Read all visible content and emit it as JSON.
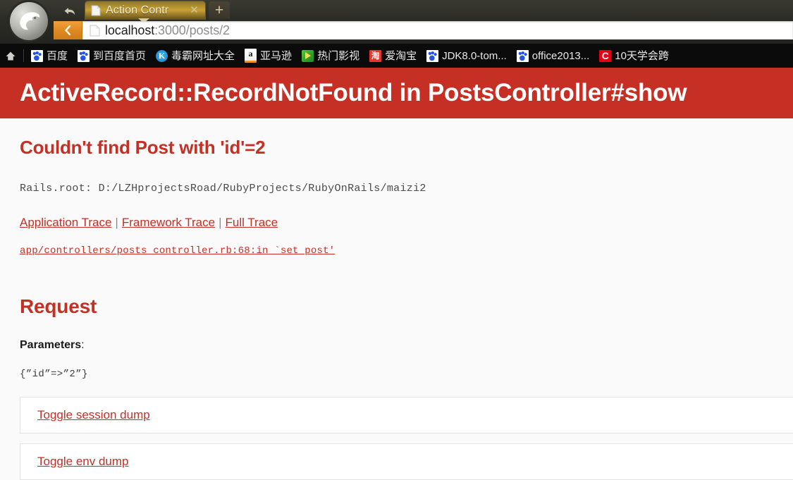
{
  "browser": {
    "logo_icon": "cheetah-browser-logo",
    "back_icon": "back-arrow-icon",
    "tab": {
      "title": "Action Contr",
      "favicon_icon": "page-favicon",
      "close_icon": "close-icon"
    },
    "new_tab_label": "+",
    "address": {
      "back_icon": "chevron-left-icon",
      "favicon_icon": "page-favicon",
      "host": "localhost",
      "path": ":3000/posts/2",
      "full_url": "localhost:3000/posts/2"
    },
    "bookmarks": {
      "home_icon": "home-icon",
      "items": [
        {
          "label": "百度",
          "icon": "baidu-paw-icon",
          "icon_class": "ico-baidu",
          "glyph": ""
        },
        {
          "label": "到百度首页",
          "icon": "baidu-paw-icon",
          "icon_class": "ico-baidu",
          "glyph": ""
        },
        {
          "label": "毒霸网址大全",
          "icon": "kingsoft-k-icon",
          "icon_class": "ico-k",
          "glyph": "K"
        },
        {
          "label": "亚马逊",
          "icon": "amazon-icon",
          "icon_class": "ico-amazon",
          "glyph": "a"
        },
        {
          "label": "热门影视",
          "icon": "video-play-icon",
          "icon_class": "ico-play",
          "glyph": ""
        },
        {
          "label": "爱淘宝",
          "icon": "taobao-icon",
          "icon_class": "ico-taobao",
          "glyph": "淘"
        },
        {
          "label": "JDK8.0-tom...",
          "icon": "baidu-paw-icon",
          "icon_class": "ico-baidu",
          "glyph": ""
        },
        {
          "label": "office2013...",
          "icon": "baidu-paw-icon",
          "icon_class": "ico-baidu",
          "glyph": ""
        },
        {
          "label": "10天学会跨",
          "icon": "cctalk-c-icon",
          "icon_class": "ico-c",
          "glyph": "C"
        }
      ]
    }
  },
  "colors": {
    "error_red": "#c52f24",
    "page_background": "#fafafa",
    "header_text": "#ffffff",
    "bookmark_bar": "#0b0b0b"
  },
  "error_page": {
    "header_title": "ActiveRecord::RecordNotFound in PostsController#show",
    "message": "Couldn't find Post with 'id'=2",
    "rails_root": "Rails.root: D:/LZHprojectsRoad/RubyProjects/RubyOnRails/maizi2",
    "trace_links": [
      {
        "label": "Application Trace"
      },
      {
        "label": "Framework Trace"
      },
      {
        "label": "Full Trace"
      }
    ],
    "trace_divider": "|",
    "trace_line": "app/controllers/posts_controller.rb:68:in `set_post'",
    "request_section": {
      "title": "Request",
      "parameters_label": "Parameters",
      "parameters_colon": ":",
      "parameters_value": "{”id”=>”2”}"
    },
    "dumps": [
      {
        "label": "Toggle session dump"
      },
      {
        "label": "Toggle env dump"
      }
    ]
  }
}
